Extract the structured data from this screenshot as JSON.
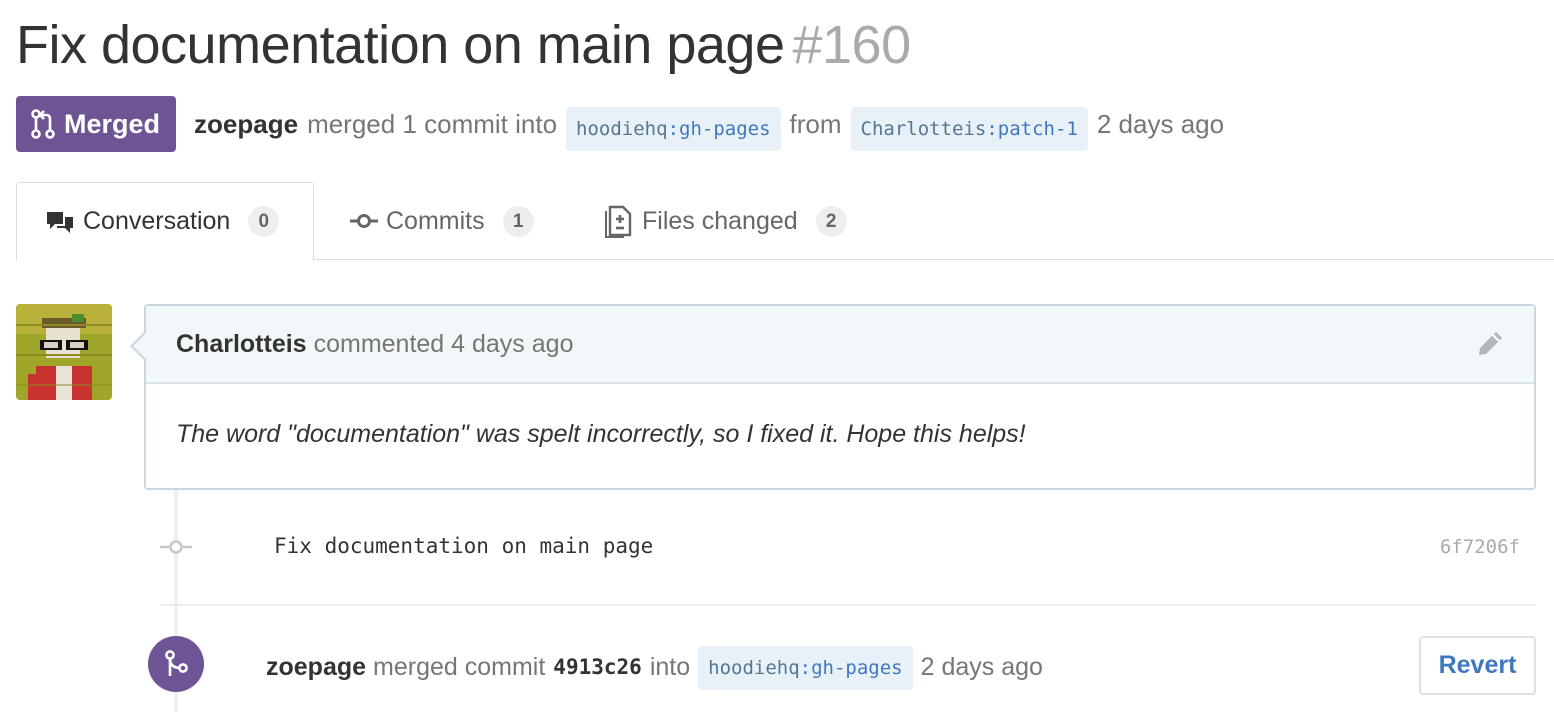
{
  "title": "Fix documentation on main page",
  "number": "#160",
  "state_label": "Merged",
  "meta": {
    "author": "zoepage",
    "action": "merged 1 commit into",
    "base_user": "hoodiehq",
    "base_branch": ":gh-pages",
    "from": "from",
    "head_user": "Charlotteis",
    "head_branch": ":patch-1",
    "time": "2 days ago"
  },
  "tabs": [
    {
      "label": "Conversation",
      "count": "0",
      "icon": "comment-discussion-icon"
    },
    {
      "label": "Commits",
      "count": "1",
      "icon": "git-commit-icon"
    },
    {
      "label": "Files changed",
      "count": "2",
      "icon": "file-diff-icon"
    }
  ],
  "comment": {
    "author": "Charlotteis",
    "meta": "commented 4 days ago",
    "body": "The word \"documentation\" was spelt incorrectly, so I fixed it. Hope this helps!"
  },
  "commit": {
    "message": "Fix documentation on main page",
    "sha": "6f7206f"
  },
  "merge_event": {
    "author": "zoepage",
    "action": "merged commit",
    "sha": "4913c26",
    "into": "into",
    "base_user": "hoodiehq",
    "base_branch": ":gh-pages",
    "time": "2 days ago",
    "revert_label": "Revert"
  },
  "colors": {
    "merged": "#6e5494",
    "link": "#4078c0",
    "branch_bg": "#e8f1f8",
    "comment_header_bg": "#f2f8fa"
  }
}
